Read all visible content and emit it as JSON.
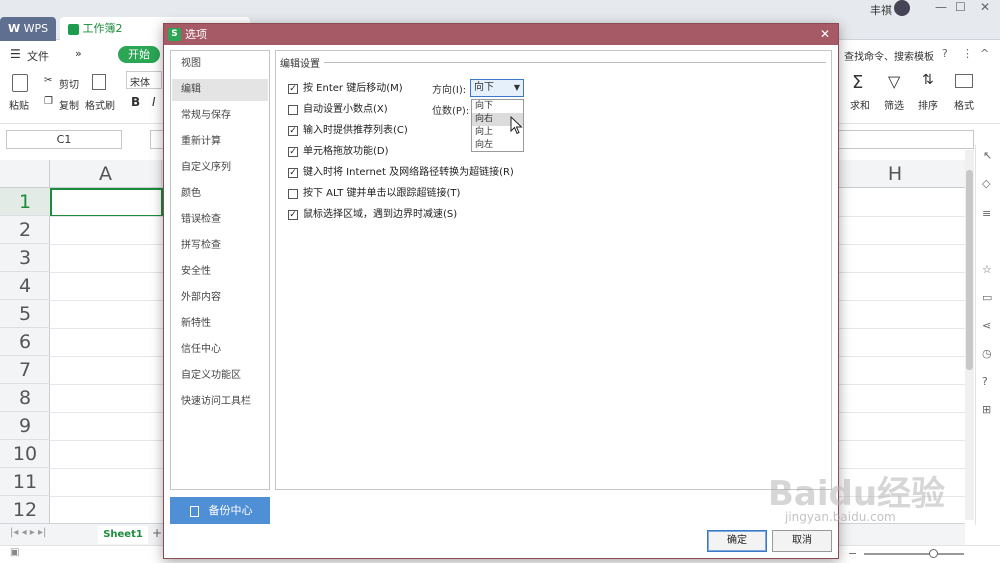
{
  "tabs": {
    "wps": "WPS",
    "workbook": "工作簿2"
  },
  "window": {
    "user": "丰祺"
  },
  "menu": {
    "file": "文件",
    "start_tab": "开始",
    "search": "查找命令、搜索模板"
  },
  "ribbon": {
    "paste": "粘贴",
    "cut": "剪切",
    "copy": "复制",
    "format_painter": "格式刷",
    "font_name": "宋体",
    "bold": "B",
    "italic": "I",
    "sum": "求和",
    "filter": "筛选",
    "sort": "排序",
    "format": "格式"
  },
  "formula_bar": {
    "cell_ref": "C1"
  },
  "grid": {
    "col_a": "A",
    "col_h": "H",
    "rows": [
      "1",
      "2",
      "3",
      "4",
      "5",
      "6",
      "7",
      "8",
      "9",
      "10",
      "11",
      "12"
    ]
  },
  "sheet": {
    "tab": "Sheet1"
  },
  "dialog": {
    "title": "选项",
    "nav": [
      "视图",
      "编辑",
      "常规与保存",
      "重新计算",
      "自定义序列",
      "颜色",
      "错误检查",
      "拼写检查",
      "安全性",
      "外部内容",
      "新特性",
      "信任中心",
      "自定义功能区",
      "快速访问工具栏"
    ],
    "nav_selected": 1,
    "backup": "备份中心",
    "section": "编辑设置",
    "options": [
      {
        "label": "按 Enter 键后移动(M)",
        "checked": true
      },
      {
        "label": "自动设置小数点(X)",
        "checked": false
      },
      {
        "label": "输入时提供推荐列表(C)",
        "checked": true
      },
      {
        "label": "单元格拖放功能(D)",
        "checked": true
      },
      {
        "label": "键入时将 Internet 及网络路径转换为超链接(R)",
        "checked": true
      },
      {
        "label": "按下 ALT 键并单击以跟踪超链接(T)",
        "checked": false
      },
      {
        "label": "鼠标选择区域，遇到边界时减速(S)",
        "checked": true
      }
    ],
    "direction_label": "方向(I):",
    "direction_value": "向下",
    "digits_label": "位数(P):",
    "direction_options": [
      "向下",
      "向右",
      "向上",
      "向左"
    ],
    "direction_highlight": 1,
    "ok": "确定",
    "cancel": "取消"
  },
  "watermark": {
    "brand": "Baidu经验",
    "url": "jingyan.baidu.com"
  }
}
